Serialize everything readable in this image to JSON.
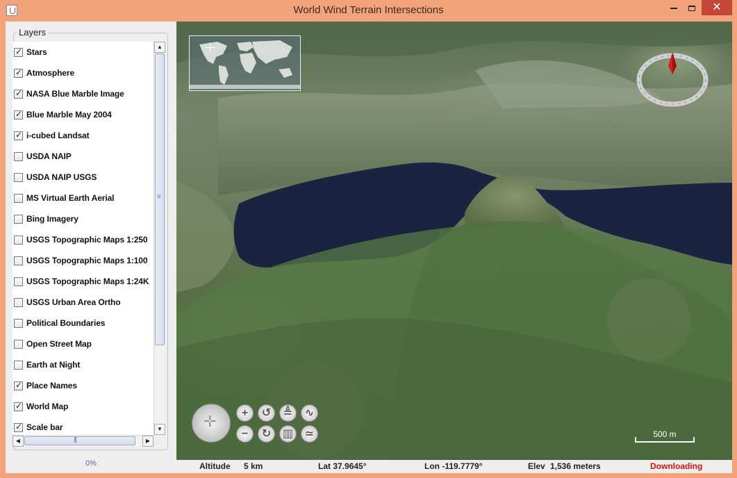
{
  "window": {
    "title": "World Wind Terrain Intersections",
    "controls": {
      "close": "✕"
    }
  },
  "layers_panel": {
    "legend": "Layers",
    "items": [
      {
        "label": "Stars",
        "checked": true
      },
      {
        "label": "Atmosphere",
        "checked": true
      },
      {
        "label": "NASA Blue Marble Image",
        "checked": true
      },
      {
        "label": "Blue Marble May 2004",
        "checked": true
      },
      {
        "label": "i-cubed Landsat",
        "checked": true
      },
      {
        "label": "USDA NAIP",
        "checked": false
      },
      {
        "label": "USDA NAIP USGS",
        "checked": false
      },
      {
        "label": "MS Virtual Earth Aerial",
        "checked": false
      },
      {
        "label": "Bing Imagery",
        "checked": false
      },
      {
        "label": "USGS Topographic Maps 1:250",
        "checked": false
      },
      {
        "label": "USGS Topographic Maps 1:100",
        "checked": false
      },
      {
        "label": "USGS Topographic Maps 1:24K",
        "checked": false
      },
      {
        "label": "USGS Urban Area Ortho",
        "checked": false
      },
      {
        "label": "Political Boundaries",
        "checked": false
      },
      {
        "label": "Open Street Map",
        "checked": false
      },
      {
        "label": "Earth at Night",
        "checked": false
      },
      {
        "label": "Place Names",
        "checked": true
      },
      {
        "label": "World Map",
        "checked": true
      },
      {
        "label": "Scale bar",
        "checked": true
      }
    ],
    "progress_text": "0%"
  },
  "globe": {
    "scale_label": "500 m",
    "nav_buttons": [
      "zoom-in",
      "rotate-left",
      "tilt-up",
      "vertical-exaggeration-up",
      "zoom-out",
      "rotate-right",
      "tilt-down",
      "vertical-exaggeration-down"
    ]
  },
  "status": {
    "altitude_label": "Altitude",
    "altitude_value": "5 km",
    "lat": "Lat 37.9645°",
    "lon": "Lon -119.7779°",
    "elev_label": "Elev",
    "elev_value": "1,536 meters",
    "download_status": "Downloading"
  },
  "colors": {
    "window_frame": "#f2a37a",
    "close_button": "#c7463a",
    "status_downloading": "#e01010",
    "lake": "#1a2340"
  }
}
